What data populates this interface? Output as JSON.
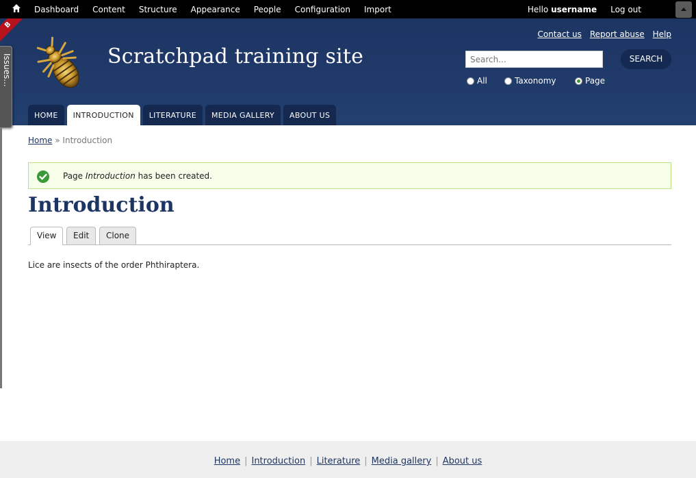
{
  "admin_toolbar": {
    "menu": [
      "Dashboard",
      "Content",
      "Structure",
      "Appearance",
      "People",
      "Configuration",
      "Import"
    ],
    "hello_prefix": "Hello ",
    "username": "username",
    "logout": "Log out"
  },
  "ribbon": {
    "text": "B"
  },
  "issues_tab": {
    "label": "Issues..."
  },
  "header": {
    "site_name": "Scratchpad training site",
    "secondary_links": [
      "Contact us",
      "Report abuse",
      "Help"
    ],
    "search": {
      "placeholder": "Search...",
      "button": "SEARCH",
      "options": [
        "All",
        "Taxonomy",
        "Page"
      ],
      "selected": "Page"
    }
  },
  "main_nav": [
    "HOME",
    "INTRODUCTION",
    "LITERATURE",
    "MEDIA GALLERY",
    "ABOUT US"
  ],
  "main_nav_active": "INTRODUCTION",
  "breadcrumb": {
    "home": "Home",
    "sep": " » ",
    "current": "Introduction"
  },
  "message": {
    "prefix": "Page ",
    "item": "Introduction",
    "suffix": " has been created."
  },
  "page": {
    "title": "Introduction",
    "tabs": [
      "View",
      "Edit",
      "Clone"
    ],
    "active_tab": "View",
    "body": "Lice are insects of the order Phthiraptera."
  },
  "footer": {
    "links": [
      "Home",
      "Introduction",
      "Literature",
      "Media gallery",
      "About us"
    ]
  },
  "colors": {
    "header_bg": "#1d3563",
    "nav_tab": "#15284f",
    "message_bg": "#f6fde9",
    "message_border": "#bde08c"
  }
}
